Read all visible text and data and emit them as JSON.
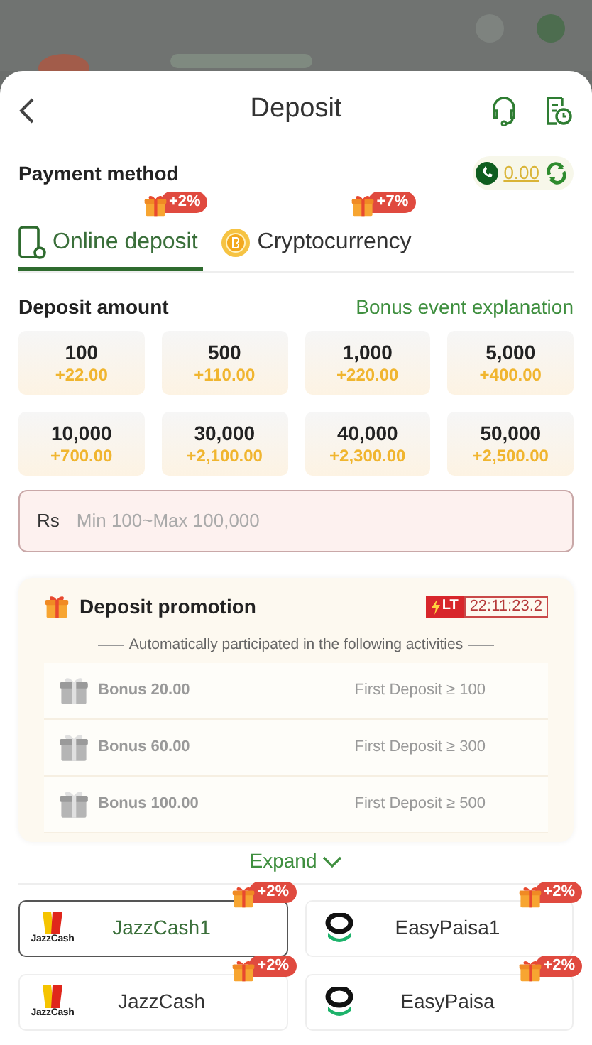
{
  "header": {
    "title": "Deposit"
  },
  "payment_method": {
    "label": "Payment method",
    "balance": "0.00"
  },
  "tabs": [
    {
      "label": "Online deposit",
      "selected": true,
      "kind": "phone",
      "bonus": "+2%"
    },
    {
      "label": "Cryptocurrency",
      "selected": false,
      "kind": "coin",
      "bonus": "+7%"
    }
  ],
  "deposit_amount": {
    "label": "Deposit amount",
    "link": "Bonus event explanation"
  },
  "amounts": [
    {
      "amount": "100",
      "bonus": "+22.00"
    },
    {
      "amount": "500",
      "bonus": "+110.00"
    },
    {
      "amount": "1,000",
      "bonus": "+220.00"
    },
    {
      "amount": "5,000",
      "bonus": "+400.00"
    },
    {
      "amount": "10,000",
      "bonus": "+700.00"
    },
    {
      "amount": "30,000",
      "bonus": "+2,100.00"
    },
    {
      "amount": "40,000",
      "bonus": "+2,300.00"
    },
    {
      "amount": "50,000",
      "bonus": "+2,500.00"
    }
  ],
  "amount_field": {
    "currency": "Rs",
    "placeholder": "Min 100~Max 100,000"
  },
  "promotion": {
    "title": "Deposit promotion",
    "badge": "LT",
    "timer": "22:11:23.2",
    "note": "Automatically participated in the following activities",
    "items": [
      {
        "bonus": "Bonus 20.00",
        "condition": "First Deposit ≥ 100"
      },
      {
        "bonus": "Bonus 60.00",
        "condition": "First Deposit ≥ 300"
      },
      {
        "bonus": "Bonus 100.00",
        "condition": "First Deposit ≥ 500"
      }
    ]
  },
  "expand": {
    "label": "Expand"
  },
  "methods": [
    {
      "name": "JazzCash1",
      "kind": "jazzcash",
      "logo_text": "JazzCash",
      "bonus": "+2%",
      "selected": true
    },
    {
      "name": "EasyPaisa1",
      "kind": "easypaisa",
      "bonus": "+2%",
      "selected": false
    },
    {
      "name": "JazzCash",
      "kind": "jazzcash",
      "logo_text": "JazzCash",
      "bonus": "+2%",
      "selected": false
    },
    {
      "name": "EasyPaisa",
      "kind": "easypaisa",
      "bonus": "+2%",
      "selected": false
    }
  ]
}
